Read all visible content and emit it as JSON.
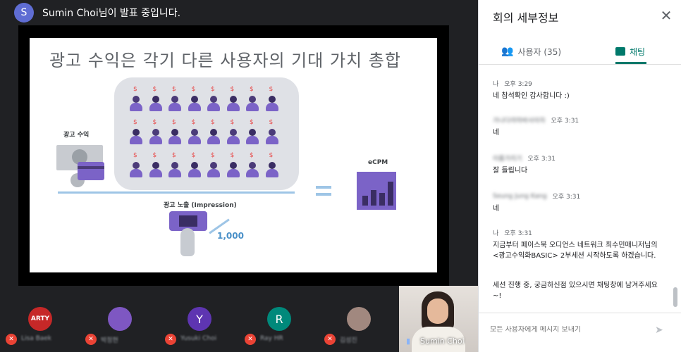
{
  "presenter": {
    "initial": "S",
    "text": "Sumin Choi님이 발표 중입니다."
  },
  "slide": {
    "title": "광고 수익은 각기 다른 사용자의 기대 가치 총합",
    "ad_revenue_label": "광고 수익",
    "impression_label": "광고 노출 (Impression)",
    "ecpm_label": "eCPM",
    "impression_count": "1,000",
    "dollar_symbol": "$"
  },
  "participants": [
    {
      "initial": "ARTY",
      "name": "Lisa Baek",
      "color": "#c62828"
    },
    {
      "initial": "",
      "name": "박정현",
      "color": "#7e57c2"
    },
    {
      "initial": "Y",
      "name": "Yusuki Choi",
      "color": "#5e35b1"
    },
    {
      "initial": "R",
      "name": "Ray HR",
      "color": "#00897b"
    },
    {
      "initial": "",
      "name": "김성진",
      "color": "#a1887f"
    }
  ],
  "self": {
    "name": "Sumin Choi"
  },
  "panel": {
    "title": "회의 세부정보",
    "tab_people": "사용자 (35)",
    "tab_chat": "채팅"
  },
  "messages": [
    {
      "sender": "나",
      "time": "오후 3:29",
      "text": "네 참석확인 감사합니다 :)",
      "blurred": false
    },
    {
      "sender": "가나다라마바사아자",
      "time": "오후 3:31",
      "text": "네",
      "blurred": true
    },
    {
      "sender": "이름가리기",
      "time": "오후 3:31",
      "text": "잘 들립니다",
      "blurred": true
    },
    {
      "sender": "Seung Jung Kang",
      "time": "오후 3:31",
      "text": "네",
      "blurred": true
    },
    {
      "sender": "나",
      "time": "오후 3:31",
      "text": "지금부터 페이스북 오디언스 네트워크 최수민매니저님의 <광고수익화BASIC> 2부세션 시작하도록 하겠습니다.",
      "blurred": false
    },
    {
      "sender": "",
      "time": "",
      "text": "세션 진행 중, 궁금하신점 있으시면 채팅창에 남겨주세요 ~!",
      "blurred": false
    }
  ],
  "composer": {
    "placeholder": "모든 사용자에게 메시지 보내기"
  },
  "colors": {
    "accent": "#00796b",
    "muted_mic": "#ea4335",
    "slide_purple": "#7b63c7"
  }
}
